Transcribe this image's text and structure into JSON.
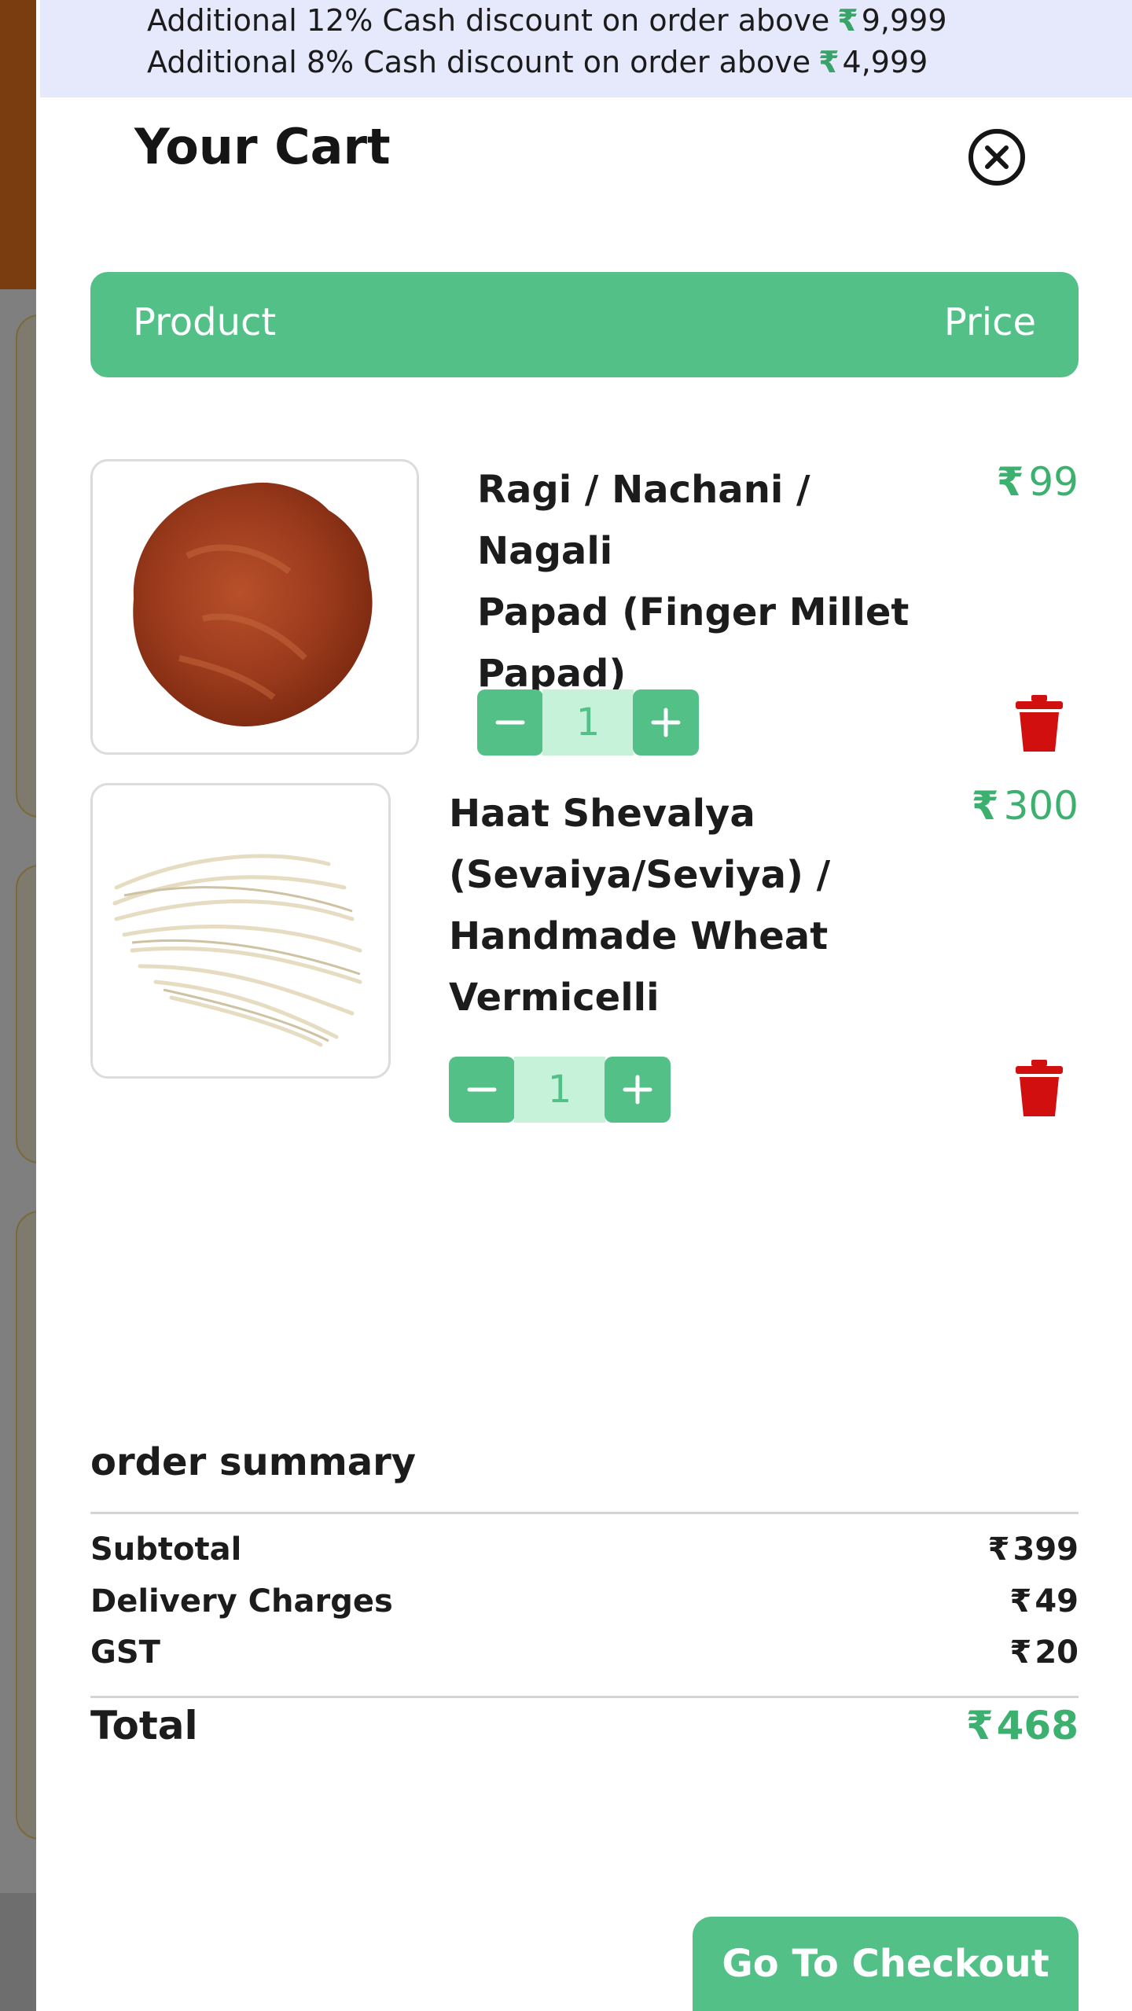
{
  "promo": {
    "line1_text": "Additional 12% Cash discount on order above",
    "line1_amount": "9,999",
    "line2_text": "Additional 8% Cash discount on order above",
    "line2_amount": "4,999",
    "currency": "₹"
  },
  "cart": {
    "title": "Your Cart",
    "close_icon": "close-circle-icon"
  },
  "table_header": {
    "product": "Product",
    "price": "Price"
  },
  "items": [
    {
      "name_lines": [
        "Ragi / Nachani / Nagali",
        "Papad (Finger Millet",
        "Papad)"
      ],
      "price": "99",
      "quantity": "1",
      "image": "ragi-papad-image"
    },
    {
      "name_lines": [
        "Haat Shevalya",
        "(Sevaiya/Seviya) /",
        "Handmade Wheat",
        "Vermicelli"
      ],
      "price": "300",
      "quantity": "1",
      "image": "wheat-vermicelli-image"
    }
  ],
  "summary": {
    "title": "order summary",
    "subtotal_label": "Subtotal",
    "subtotal_value": "399",
    "delivery_label": "Delivery Charges",
    "delivery_value": "49",
    "gst_label": "GST",
    "gst_value": "20",
    "total_label": "Total",
    "total_value": "468"
  },
  "checkout": {
    "label": "Go To Checkout"
  },
  "colors": {
    "accent": "#53c088",
    "price_green": "#3cb06f",
    "stepper_light": "#c6f2da",
    "trash_red": "#d10f0f",
    "promo_bg": "#e6e8fb"
  }
}
